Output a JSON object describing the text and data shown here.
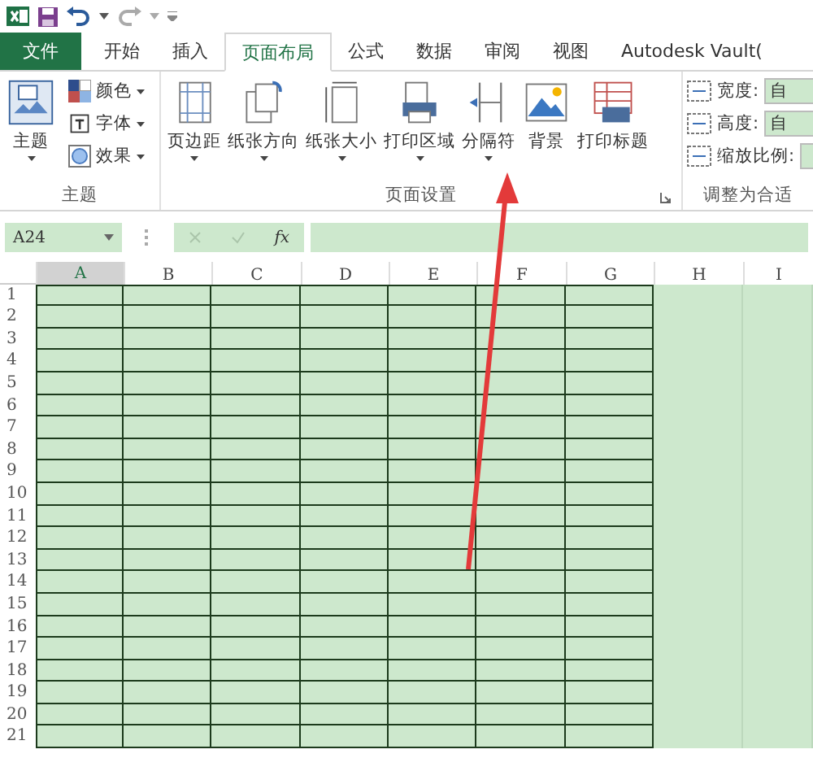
{
  "tabs": [
    {
      "label": "文件",
      "kind": "file",
      "selected": false
    },
    {
      "label": "开始",
      "kind": "tab",
      "selected": false
    },
    {
      "label": "插入",
      "kind": "tab",
      "selected": false
    },
    {
      "label": "页面布局",
      "kind": "tab",
      "selected": true
    },
    {
      "label": "公式",
      "kind": "tab",
      "selected": false
    },
    {
      "label": "数据",
      "kind": "tab",
      "selected": false
    },
    {
      "label": "审阅",
      "kind": "tab",
      "selected": false
    },
    {
      "label": "视图",
      "kind": "tab",
      "selected": false
    },
    {
      "label": "Autodesk Vault(",
      "kind": "tab",
      "selected": false
    }
  ],
  "ribbon": {
    "groups": [
      {
        "label": "主题",
        "launcher": false,
        "items": [
          {
            "kind": "large",
            "label": "主题",
            "dropdown": true
          },
          {
            "kind": "small",
            "label": "颜色",
            "dropdown": true
          },
          {
            "kind": "small",
            "label": "字体",
            "dropdown": true
          },
          {
            "kind": "small",
            "label": "效果",
            "dropdown": true
          }
        ]
      },
      {
        "label": "页面设置",
        "launcher": true,
        "items": [
          {
            "kind": "large",
            "label": "页边距",
            "dropdown": true
          },
          {
            "kind": "large",
            "label": "纸张方向",
            "dropdown": true
          },
          {
            "kind": "large",
            "label": "纸张大小",
            "dropdown": true
          },
          {
            "kind": "large",
            "label": "打印区域",
            "dropdown": true
          },
          {
            "kind": "large",
            "label": "分隔符",
            "dropdown": true
          },
          {
            "kind": "large",
            "label": "背景",
            "dropdown": false
          },
          {
            "kind": "large",
            "label": "打印标题",
            "dropdown": false
          }
        ]
      },
      {
        "label": "调整为合适",
        "launcher": false,
        "items": [
          {
            "kind": "field",
            "label": "宽度:",
            "value": "自"
          },
          {
            "kind": "field",
            "label": "高度:",
            "value": "自"
          },
          {
            "kind": "field",
            "label": "缩放比例:",
            "value": ""
          }
        ]
      }
    ]
  },
  "formula_bar": {
    "name_box": "A24",
    "fx": "fx"
  },
  "sheet": {
    "columns": [
      {
        "label": "A",
        "selected": true,
        "bordered": true
      },
      {
        "label": "B",
        "selected": false,
        "bordered": true
      },
      {
        "label": "C",
        "selected": false,
        "bordered": true
      },
      {
        "label": "D",
        "selected": false,
        "bordered": true
      },
      {
        "label": "E",
        "selected": false,
        "bordered": true
      },
      {
        "label": "F",
        "selected": false,
        "bordered": true
      },
      {
        "label": "G",
        "selected": false,
        "bordered": true
      },
      {
        "label": "H",
        "selected": false,
        "bordered": false
      },
      {
        "label": "I",
        "selected": false,
        "bordered": false
      }
    ],
    "rows": [
      "1",
      "2",
      "3",
      "4",
      "5",
      "6",
      "7",
      "8",
      "9",
      "10",
      "11",
      "12",
      "13",
      "14",
      "15",
      "16",
      "17",
      "18",
      "19",
      "20",
      "21"
    ]
  },
  "annotations": [
    {
      "kind": "arrow"
    }
  ]
}
